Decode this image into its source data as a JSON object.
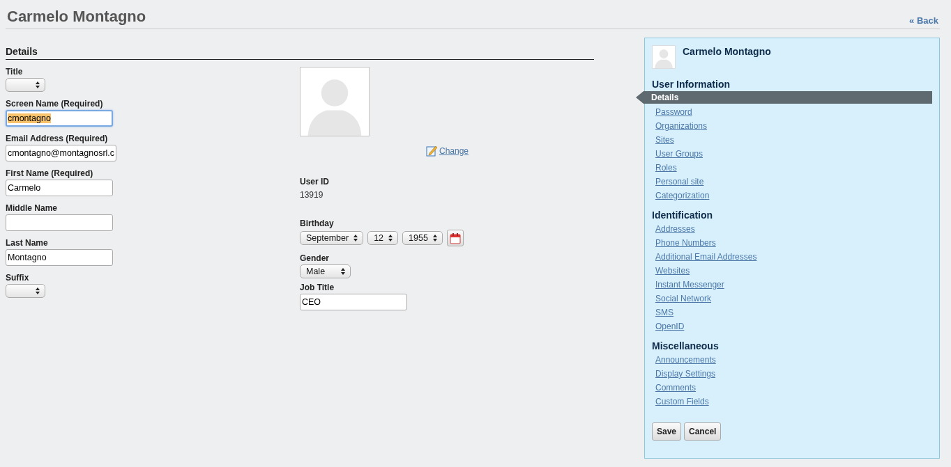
{
  "header": {
    "title": "Carmelo Montagno",
    "back_link": "« Back"
  },
  "details": {
    "heading": "Details",
    "fields": [
      {
        "kind": "select",
        "label": "Title",
        "focused": false
      },
      {
        "kind": "text",
        "label": "Screen Name (Required)",
        "value": "cmontagno",
        "focused": true
      },
      {
        "kind": "text",
        "label": "Email Address (Required)",
        "value": "cmontagno@montagnosrl.c",
        "focused": false
      },
      {
        "kind": "text",
        "label": "First Name (Required)",
        "value": "Carmelo",
        "focused": false
      },
      {
        "kind": "text",
        "label": "Middle Name",
        "focused": false
      },
      {
        "kind": "text",
        "label": "Last Name",
        "value": "Montagno",
        "focused": false
      },
      {
        "kind": "select",
        "label": "Suffix",
        "focused": false
      }
    ],
    "change_link": "Change",
    "user_id": {
      "label": "User ID",
      "value": "13919"
    },
    "birthday": {
      "label": "Birthday",
      "month": "September",
      "day": "12",
      "year": "1955"
    },
    "gender": {
      "label": "Gender",
      "value": "Male"
    },
    "job_title": {
      "label": "Job Title",
      "value": "CEO"
    }
  },
  "sidebar": {
    "name": "Carmelo Montagno",
    "sections": [
      {
        "heading": "User Information",
        "items": [
          {
            "label": "Details",
            "selected": true
          },
          {
            "label": "Password",
            "selected": false
          },
          {
            "label": "Organizations",
            "selected": false
          },
          {
            "label": "Sites",
            "selected": false
          },
          {
            "label": "User Groups",
            "selected": false
          },
          {
            "label": "Roles",
            "selected": false
          },
          {
            "label": "Personal site",
            "selected": false
          },
          {
            "label": "Categorization",
            "selected": false
          }
        ]
      },
      {
        "heading": "Identification",
        "items": [
          {
            "label": "Addresses",
            "selected": false
          },
          {
            "label": "Phone Numbers",
            "selected": false
          },
          {
            "label": "Additional Email Addresses",
            "selected": false
          },
          {
            "label": "Websites",
            "selected": false
          },
          {
            "label": "Instant Messenger",
            "selected": false
          },
          {
            "label": "Social Network",
            "selected": false
          },
          {
            "label": "SMS",
            "selected": false
          },
          {
            "label": "OpenID",
            "selected": false
          }
        ]
      },
      {
        "heading": "Miscellaneous",
        "items": [
          {
            "label": "Announcements",
            "selected": false
          },
          {
            "label": "Display Settings",
            "selected": false
          },
          {
            "label": "Comments",
            "selected": false
          },
          {
            "label": "Custom Fields",
            "selected": false
          }
        ]
      }
    ],
    "buttons": [
      "Save",
      "Cancel"
    ]
  }
}
